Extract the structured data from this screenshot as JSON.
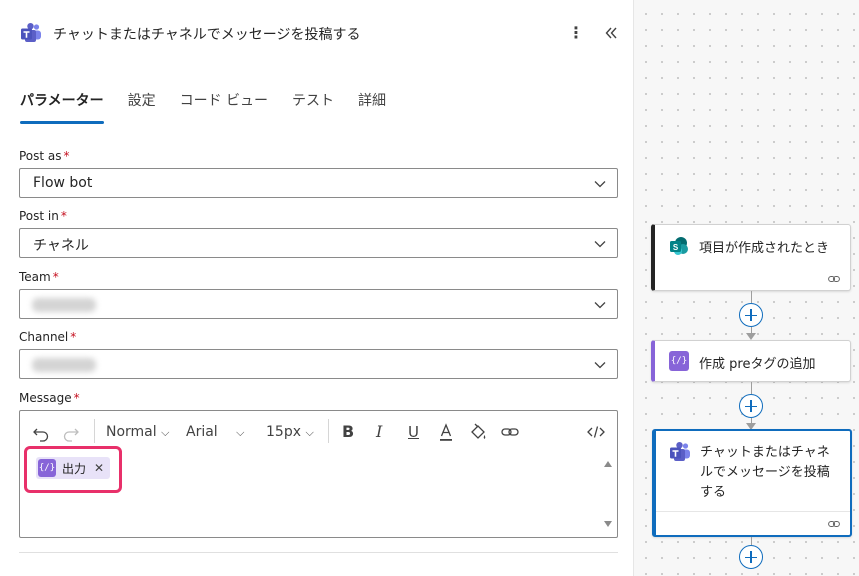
{
  "panel": {
    "title": "チャットまたはチャネルでメッセージを投稿する",
    "tabs": [
      "パラメーター",
      "設定",
      "コード ビュー",
      "テスト",
      "詳細"
    ],
    "active_tab": "パラメーター"
  },
  "fields": {
    "post_as": {
      "label": "Post as",
      "required": "*",
      "value": "Flow bot"
    },
    "post_in": {
      "label": "Post in",
      "required": "*",
      "value": "チャネル"
    },
    "team": {
      "label": "Team",
      "required": "*",
      "value": ""
    },
    "channel": {
      "label": "Channel",
      "required": "*",
      "value": ""
    },
    "message": {
      "label": "Message",
      "required": "*"
    }
  },
  "editor": {
    "format": "Normal",
    "font": "Arial",
    "size": "15px",
    "token_label": "出力",
    "token_icon": "{/}"
  },
  "flow": {
    "nodes": [
      {
        "label": "項目が作成されたとき",
        "icon": "sharepoint-icon"
      },
      {
        "label": "作成 preタグの追加",
        "icon": "compose-icon"
      },
      {
        "label_lines": [
          "チャットまたはチャネ",
          "ルでメッセージを投稿",
          "する"
        ],
        "icon": "teams-icon"
      }
    ]
  },
  "colors": {
    "accent": "#0f6cbd",
    "highlight": "#e8306a",
    "teams": "#5b5fc7",
    "compose": "#8764d8",
    "sharepoint": "#038387"
  }
}
